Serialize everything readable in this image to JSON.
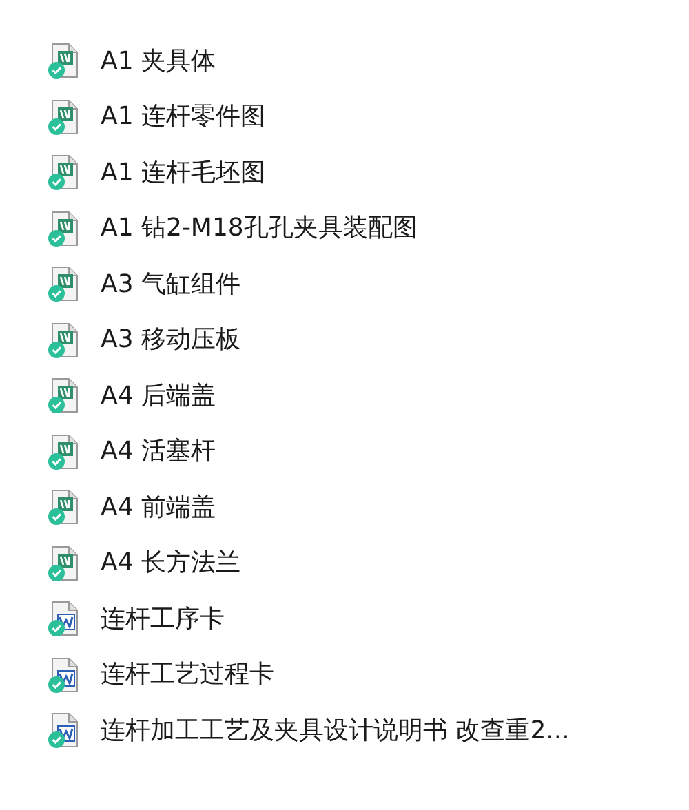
{
  "files": [
    {
      "name": "A1 夹具体",
      "kind": "dwg",
      "synced": true
    },
    {
      "name": "A1 连杆零件图",
      "kind": "dwg",
      "synced": true
    },
    {
      "name": "A1 连杆毛坯图",
      "kind": "dwg",
      "synced": true
    },
    {
      "name": "A1 钻2-M18孔孔夹具装配图",
      "kind": "dwg",
      "synced": true
    },
    {
      "name": "A3 气缸组件",
      "kind": "dwg",
      "synced": true
    },
    {
      "name": "A3 移动压板",
      "kind": "dwg",
      "synced": true
    },
    {
      "name": "A4 后端盖",
      "kind": "dwg",
      "synced": true
    },
    {
      "name": "A4 活塞杆",
      "kind": "dwg",
      "synced": true
    },
    {
      "name": "A4 前端盖",
      "kind": "dwg",
      "synced": true
    },
    {
      "name": "A4 长方法兰",
      "kind": "dwg",
      "synced": true
    },
    {
      "name": "连杆工序卡",
      "kind": "word",
      "synced": true
    },
    {
      "name": "连杆工艺过程卡",
      "kind": "word",
      "synced": true
    },
    {
      "name": "连杆加工工艺及夹具设计说明书 改查重2...",
      "kind": "word",
      "synced": true
    }
  ]
}
